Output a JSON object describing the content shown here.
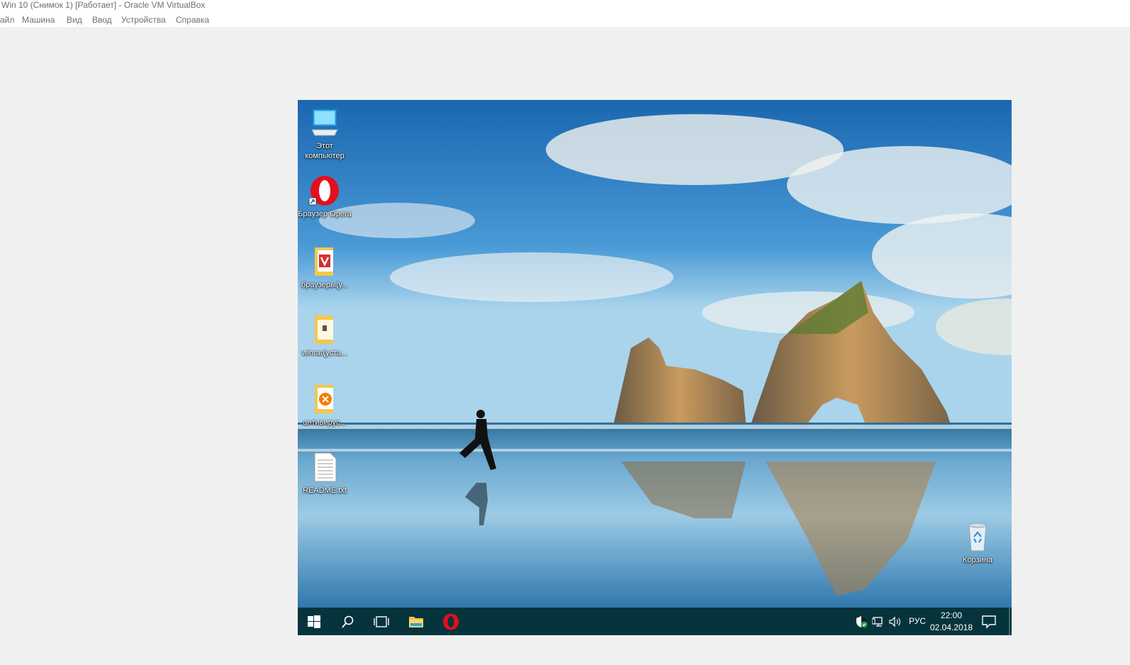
{
  "window": {
    "title": "Win 10 (Снимок 1) [Работает] - Oracle VM VirtualBox"
  },
  "menu": {
    "items": [
      "айл",
      "Машина",
      "Вид",
      "Ввод",
      "Устройства",
      "Справка"
    ]
  },
  "desktop": {
    "icons": [
      {
        "label": "Этот компьютер",
        "icon": "this-pc-icon"
      },
      {
        "label": "Браузер Opera",
        "icon": "opera-icon"
      },
      {
        "label": "браузеры(у...",
        "icon": "folder-icon"
      },
      {
        "label": "winrar(уста...",
        "icon": "folder-icon"
      },
      {
        "label": "антивирус...",
        "icon": "folder-icon"
      },
      {
        "label": "README.txt",
        "icon": "text-file-icon"
      }
    ],
    "recycle_bin": {
      "label": "Корзина",
      "icon": "recycle-bin-icon"
    }
  },
  "taskbar": {
    "buttons": [
      "start-icon",
      "search-icon",
      "task-view-icon",
      "file-explorer-icon",
      "opera-icon"
    ],
    "tray": {
      "icons": [
        "windows-defender-icon",
        "network-icon",
        "volume-icon"
      ],
      "language": "РУС",
      "time": "22:00",
      "date": "02.04.2018",
      "notification_icon": "action-center-icon"
    },
    "background_color": "#06343d"
  }
}
